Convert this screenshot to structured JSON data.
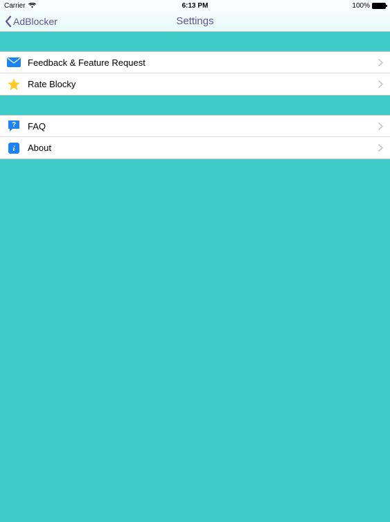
{
  "status": {
    "carrier": "Carrier",
    "time": "6:13 PM",
    "battery": "100%"
  },
  "nav": {
    "back_label": "AdBlocker",
    "title": "Settings"
  },
  "groups": [
    {
      "items": [
        {
          "icon": "mail-icon",
          "label": "Feedback & Feature Request",
          "name": "row-feedback"
        },
        {
          "icon": "star-icon",
          "label": "Rate Blocky",
          "name": "row-rate"
        }
      ]
    },
    {
      "items": [
        {
          "icon": "question-icon",
          "label": "FAQ",
          "name": "row-faq"
        },
        {
          "icon": "info-icon",
          "label": "About",
          "name": "row-about"
        }
      ]
    }
  ]
}
